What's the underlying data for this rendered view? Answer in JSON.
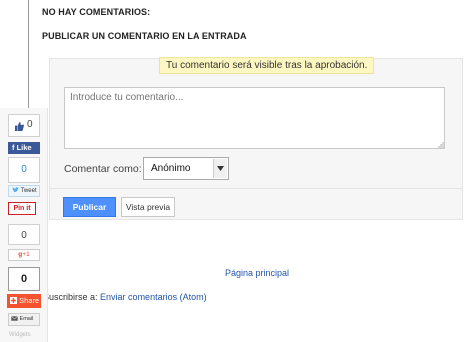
{
  "post": {
    "no_comments": "NO HAY COMENTARIOS:",
    "publish_title": "PUBLICAR UN COMENTARIO EN LA ENTRADA"
  },
  "comment_form": {
    "notice": "Tu comentario será visible tras la aprobación.",
    "textarea_placeholder": "Introduce tu comentario...",
    "comment_as_label": "Comentar como:",
    "identity_selected": "Anónimo",
    "publish_button": "Publicar",
    "preview_button": "Vista previa"
  },
  "footer": {
    "home_link": "Página principal",
    "subscribe_prefix": "Suscribirse a:",
    "subscribe_link": "Enviar comentarios (Atom)"
  },
  "share_bar": {
    "like_count": "0",
    "facebook_like": "Like",
    "tweet_count": "0",
    "tweet_label": "Tweet",
    "pinterest_label": "Pin it",
    "google_count": "0",
    "google_plus_label": "+1",
    "total_share_count": "0",
    "share_label": "Share",
    "email_label": "Email",
    "widgets_label": "Widgets"
  }
}
